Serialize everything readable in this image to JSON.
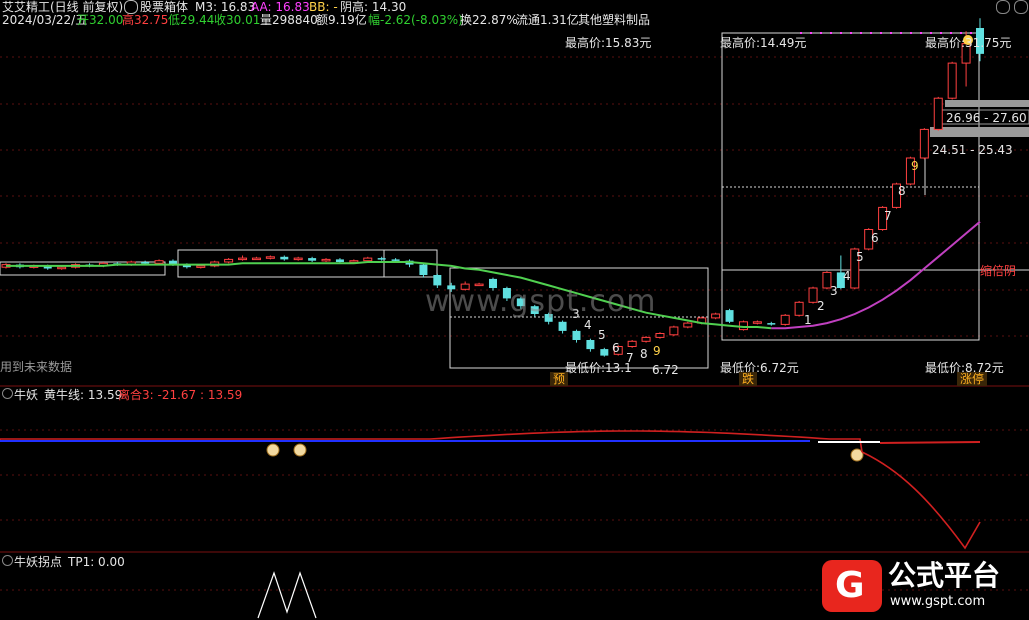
{
  "header": {
    "title": "艾艾精工(日线 前复权)",
    "indicator_name": "股票箱体",
    "m3": "M3: 16.83",
    "aa": "AA: 16.83",
    "bb": "BB: -",
    "yin_high": "阴高: 14.30",
    "date": "2024/03/22/五",
    "open": "开32.00",
    "high": "高32.75",
    "low": "低29.44",
    "close": "收30.01",
    "volume": "量298840",
    "amount": "额9.19亿",
    "change": "幅-2.62(-8.03%)",
    "turnover": "换22.87%",
    "float": "流通1.31亿",
    "sector": "其他塑料制品"
  },
  "main_panel": {
    "future_data_note": "用到未来数据",
    "box_labels": {
      "high1": "最高价:15.83元",
      "high2": "最高价:14.49元",
      "high3": "最高价:31.75元",
      "low1": "最低价:13.1",
      "low1b": "6.72",
      "low2": "最低价:6.72元",
      "low3": "最低价:8.72元",
      "range1": "26.96 - 27.60",
      "range2": "24.51 - 25.43",
      "double_yin": "缩倍阴"
    },
    "tags": {
      "yu": "预",
      "die": "跌",
      "zhangting": "涨停"
    },
    "count_labels": [
      "1",
      "2",
      "3",
      "4",
      "5",
      "6",
      "7",
      "8",
      "9"
    ],
    "down_count_labels": [
      "3",
      "4",
      "5",
      "6",
      "7",
      "8",
      "9"
    ],
    "watermark": "www.gspt.com"
  },
  "panel2": {
    "name": "牛妖",
    "series1": "黄牛线: 13.59",
    "series2": "离合3: -21.67 : 13.59"
  },
  "panel3": {
    "name": "牛妖拐点",
    "series1": "TP1: 0.00"
  },
  "logo": {
    "glyph": "G",
    "title": "公式平台",
    "url": "www.gspt.com"
  },
  "colors": {
    "up": "#ff4040",
    "down": "#60e0e0",
    "ma": "#50d050",
    "ma2": "#c040c0",
    "red_line": "#d02020",
    "blue_line": "#2030ff",
    "grid": "#7a1010"
  },
  "chart_data": [
    {
      "type": "candlestick",
      "title": "艾艾精工(日线 前复权)",
      "ylim": [
        6.0,
        33.0
      ],
      "box_ranges": [
        {
          "high": 15.83,
          "low": 13.1
        },
        {
          "high": 14.49,
          "low": 6.72
        },
        {
          "high": 31.75,
          "low": 8.72
        }
      ],
      "candles": [
        {
          "o": 13.6,
          "c": 13.8,
          "h": 13.9,
          "l": 13.5
        },
        {
          "o": 13.8,
          "c": 13.6,
          "h": 13.9,
          "l": 13.5
        },
        {
          "o": 13.6,
          "c": 13.7,
          "h": 13.8,
          "l": 13.5
        },
        {
          "o": 13.7,
          "c": 13.5,
          "h": 13.8,
          "l": 13.4
        },
        {
          "o": 13.5,
          "c": 13.6,
          "h": 13.7,
          "l": 13.4
        },
        {
          "o": 13.6,
          "c": 13.8,
          "h": 13.9,
          "l": 13.5
        },
        {
          "o": 13.8,
          "c": 13.7,
          "h": 13.9,
          "l": 13.6
        },
        {
          "o": 13.7,
          "c": 13.9,
          "h": 14.0,
          "l": 13.6
        },
        {
          "o": 13.9,
          "c": 13.8,
          "h": 14.0,
          "l": 13.7
        },
        {
          "o": 13.8,
          "c": 14.0,
          "h": 14.1,
          "l": 13.7
        },
        {
          "o": 14.0,
          "c": 13.9,
          "h": 14.1,
          "l": 13.8
        },
        {
          "o": 13.9,
          "c": 14.1,
          "h": 14.2,
          "l": 13.8
        },
        {
          "o": 14.1,
          "c": 13.8,
          "h": 14.2,
          "l": 13.7
        },
        {
          "o": 13.8,
          "c": 13.6,
          "h": 13.9,
          "l": 13.5
        },
        {
          "o": 13.6,
          "c": 13.7,
          "h": 13.8,
          "l": 13.5
        },
        {
          "o": 13.7,
          "c": 14.0,
          "h": 14.1,
          "l": 13.6
        },
        {
          "o": 14.0,
          "c": 14.2,
          "h": 14.3,
          "l": 13.9
        },
        {
          "o": 14.2,
          "c": 14.3,
          "h": 14.5,
          "l": 14.1
        },
        {
          "o": 14.3,
          "c": 14.3,
          "h": 14.4,
          "l": 14.2
        },
        {
          "o": 14.3,
          "c": 14.4,
          "h": 14.5,
          "l": 14.2
        },
        {
          "o": 14.4,
          "c": 14.2,
          "h": 14.5,
          "l": 14.1
        },
        {
          "o": 14.2,
          "c": 14.3,
          "h": 14.4,
          "l": 14.1
        },
        {
          "o": 14.3,
          "c": 14.1,
          "h": 14.4,
          "l": 14.0
        },
        {
          "o": 14.1,
          "c": 14.2,
          "h": 14.3,
          "l": 14.0
        },
        {
          "o": 14.2,
          "c": 14.0,
          "h": 14.3,
          "l": 13.9
        },
        {
          "o": 14.0,
          "c": 14.1,
          "h": 14.2,
          "l": 13.9
        },
        {
          "o": 14.1,
          "c": 14.3,
          "h": 14.4,
          "l": 14.0
        },
        {
          "o": 14.3,
          "c": 14.2,
          "h": 14.4,
          "l": 14.1
        },
        {
          "o": 14.2,
          "c": 14.1,
          "h": 14.3,
          "l": 14.0
        },
        {
          "o": 14.1,
          "c": 13.8,
          "h": 14.2,
          "l": 13.6
        },
        {
          "o": 13.8,
          "c": 13.0,
          "h": 13.9,
          "l": 12.8
        },
        {
          "o": 13.0,
          "c": 12.2,
          "h": 13.1,
          "l": 12.0
        },
        {
          "o": 12.2,
          "c": 11.9,
          "h": 12.4,
          "l": 11.7
        },
        {
          "o": 11.9,
          "c": 12.3,
          "h": 12.5,
          "l": 11.8
        },
        {
          "o": 12.3,
          "c": 12.3,
          "h": 12.4,
          "l": 12.2
        },
        {
          "o": 12.7,
          "c": 12.0,
          "h": 12.8,
          "l": 11.8
        },
        {
          "o": 12.0,
          "c": 11.2,
          "h": 12.1,
          "l": 11.0
        },
        {
          "o": 11.2,
          "c": 10.6,
          "h": 11.3,
          "l": 10.4
        },
        {
          "o": 10.6,
          "c": 10.0,
          "h": 10.7,
          "l": 9.8
        },
        {
          "o": 10.0,
          "c": 9.4,
          "h": 10.1,
          "l": 9.2
        },
        {
          "o": 9.4,
          "c": 8.7,
          "h": 9.5,
          "l": 8.5
        },
        {
          "o": 8.7,
          "c": 8.0,
          "h": 8.8,
          "l": 7.8
        },
        {
          "o": 8.0,
          "c": 7.3,
          "h": 8.1,
          "l": 7.1
        },
        {
          "o": 7.3,
          "c": 6.8,
          "h": 7.4,
          "l": 6.72
        },
        {
          "o": 6.9,
          "c": 7.5,
          "h": 7.6,
          "l": 6.8
        },
        {
          "o": 7.5,
          "c": 7.9,
          "h": 8.0,
          "l": 7.4
        },
        {
          "o": 7.9,
          "c": 8.2,
          "h": 8.3,
          "l": 7.8
        },
        {
          "o": 8.2,
          "c": 8.5,
          "h": 8.6,
          "l": 8.1
        },
        {
          "o": 8.4,
          "c": 9.0,
          "h": 9.1,
          "l": 8.3
        },
        {
          "o": 9.0,
          "c": 9.3,
          "h": 9.4,
          "l": 8.9
        },
        {
          "o": 9.3,
          "c": 9.7,
          "h": 9.8,
          "l": 9.2
        },
        {
          "o": 9.7,
          "c": 10.0,
          "h": 10.1,
          "l": 9.6
        },
        {
          "o": 10.3,
          "c": 9.4,
          "h": 10.4,
          "l": 9.3
        },
        {
          "o": 8.8,
          "c": 9.4,
          "h": 9.5,
          "l": 8.72
        },
        {
          "o": 9.3,
          "c": 9.4,
          "h": 9.5,
          "l": 9.2
        },
        {
          "o": 9.3,
          "c": 9.2,
          "h": 9.4,
          "l": 9.1
        },
        {
          "o": 9.2,
          "c": 9.9,
          "h": 10.0,
          "l": 9.1
        },
        {
          "o": 9.9,
          "c": 10.9,
          "h": 11.0,
          "l": 9.8
        },
        {
          "o": 10.9,
          "c": 12.0,
          "h": 12.1,
          "l": 10.8
        },
        {
          "o": 12.0,
          "c": 13.2,
          "h": 13.3,
          "l": 11.9
        },
        {
          "o": 13.2,
          "c": 12.0,
          "h": 14.5,
          "l": 11.9
        },
        {
          "o": 12.0,
          "c": 15.0,
          "h": 15.1,
          "l": 11.9
        },
        {
          "o": 15.0,
          "c": 16.5,
          "h": 16.6,
          "l": 14.9
        },
        {
          "o": 16.5,
          "c": 18.2,
          "h": 18.3,
          "l": 16.4
        },
        {
          "o": 18.2,
          "c": 20.0,
          "h": 20.1,
          "l": 18.1
        },
        {
          "o": 20.0,
          "c": 22.0,
          "h": 22.1,
          "l": 19.9
        },
        {
          "o": 22.0,
          "c": 24.2,
          "h": 24.3,
          "l": 21.9
        },
        {
          "o": 24.2,
          "c": 26.6,
          "h": 26.7,
          "l": 24.1
        },
        {
          "o": 26.6,
          "c": 29.3,
          "h": 29.4,
          "l": 26.5
        },
        {
          "o": 29.3,
          "c": 30.8,
          "h": 31.75,
          "l": 27.5
        },
        {
          "o": 32.0,
          "c": 30.01,
          "h": 32.75,
          "l": 29.44
        }
      ],
      "ma": [
        13.7,
        13.7,
        13.7,
        13.7,
        13.7,
        13.7,
        13.7,
        13.7,
        13.8,
        13.8,
        13.8,
        13.8,
        13.8,
        13.8,
        13.8,
        13.8,
        13.8,
        13.9,
        13.9,
        13.9,
        13.9,
        13.9,
        13.9,
        13.9,
        13.9,
        13.9,
        14.0,
        14.0,
        14.0,
        14.0,
        13.9,
        13.8,
        13.7,
        13.5,
        13.4,
        13.2,
        13.0,
        12.8,
        12.5,
        12.2,
        11.9,
        11.6,
        11.3,
        11.0,
        10.7,
        10.4,
        10.1,
        9.9,
        9.7,
        9.5,
        9.3,
        9.2,
        9.1,
        9.0,
        9.0,
        8.9,
        8.9,
        9.0,
        9.1,
        9.3,
        9.6,
        10.0,
        10.5,
        11.1,
        11.8,
        12.6,
        13.5,
        14.4,
        15.3,
        16.2,
        17.1
      ]
    },
    {
      "type": "line",
      "name": "牛妖",
      "series": [
        {
          "name": "黄牛线",
          "last": 13.59
        },
        {
          "name": "离合3",
          "last": -21.67
        }
      ]
    },
    {
      "type": "line",
      "name": "牛妖拐点",
      "series": [
        {
          "name": "TP1",
          "last": 0.0
        }
      ]
    }
  ]
}
